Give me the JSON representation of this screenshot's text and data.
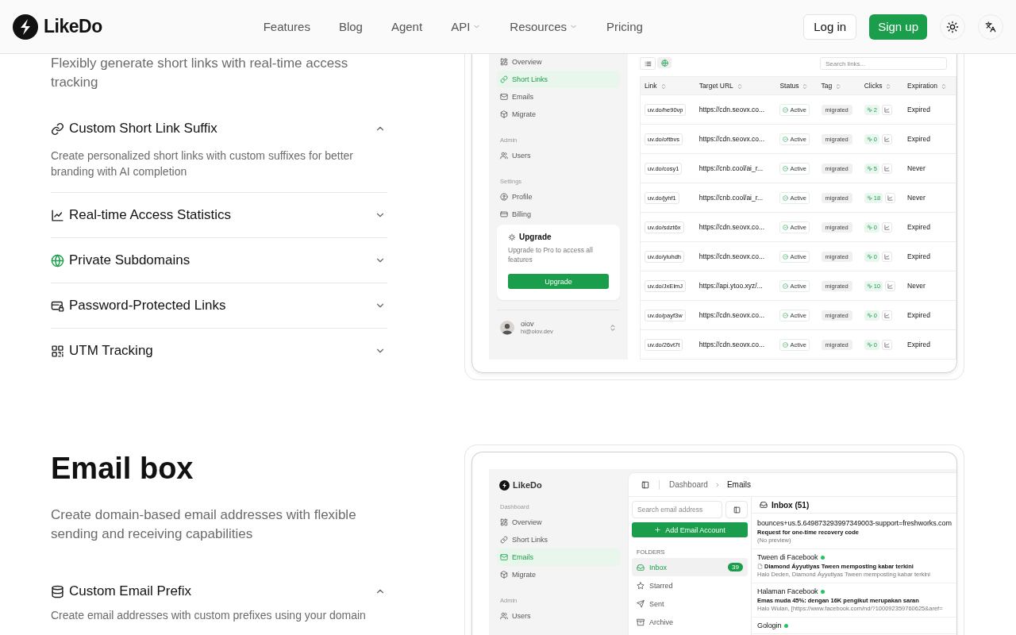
{
  "header": {
    "logo": "LikeDo",
    "nav": [
      {
        "label": "Features",
        "dropdown": false
      },
      {
        "label": "Blog",
        "dropdown": false
      },
      {
        "label": "Agent",
        "dropdown": false
      },
      {
        "label": "API",
        "dropdown": true
      },
      {
        "label": "Resources",
        "dropdown": true
      },
      {
        "label": "Pricing",
        "dropdown": false
      }
    ],
    "login": "Log in",
    "signup": "Sign up"
  },
  "short_links": {
    "description": "Flexibly generate short links with real-time access tracking",
    "features": [
      {
        "title": "Custom Short Link Suffix",
        "expanded": true,
        "description": "Create personalized short links with custom suffixes for better branding with AI completion"
      },
      {
        "title": "Real-time Access Statistics",
        "expanded": false
      },
      {
        "title": "Private Subdomains",
        "expanded": false
      },
      {
        "title": "Password-Protected Links",
        "expanded": false
      },
      {
        "title": "UTM Tracking",
        "expanded": false
      }
    ],
    "preview": {
      "sidebar": {
        "groups": [
          {
            "items": [
              {
                "label": "Overview",
                "selected": false
              },
              {
                "label": "Short Links",
                "selected": true
              },
              {
                "label": "Emails",
                "selected": false
              },
              {
                "label": "Migrate",
                "selected": false
              }
            ]
          },
          {
            "label": "Admin",
            "items": [
              {
                "label": "Users",
                "selected": false
              }
            ]
          },
          {
            "label": "Settings",
            "items": [
              {
                "label": "Profile",
                "selected": false
              },
              {
                "label": "Billing",
                "selected": false
              }
            ]
          }
        ],
        "upgrade": {
          "title": "Upgrade",
          "text": "Upgrade to Pro to access all features",
          "button": "Upgrade"
        },
        "user": {
          "name": "oiov",
          "email": "hi@oiov.dev"
        }
      },
      "search_placeholder": "Search links...",
      "columns": [
        "Link",
        "Target URL",
        "Status",
        "Tag",
        "Clicks",
        "Expiration"
      ],
      "rows": [
        {
          "link": "uv.do/he90vp",
          "url": "https://cdn.seovx.co...",
          "status": "Active",
          "tag": "migrated",
          "clicks": "2",
          "expiration": "Expired"
        },
        {
          "link": "uv.do/oftbvs",
          "url": "https://cdn.seovx.co...",
          "status": "Active",
          "tag": "migrated",
          "clicks": "0",
          "expiration": "Expired"
        },
        {
          "link": "uv.do/cosy1",
          "url": "https://cnb.cool/ai_r...",
          "status": "Active",
          "tag": "migrated",
          "clicks": "5",
          "expiration": "Never"
        },
        {
          "link": "uv.do/jyhf1",
          "url": "https://cnb.cool/ai_r...",
          "status": "Active",
          "tag": "migrated",
          "clicks": "18",
          "expiration": "Never"
        },
        {
          "link": "uv.do/sdzt6x",
          "url": "https://cdn.seovx.co...",
          "status": "Active",
          "tag": "migrated",
          "clicks": "0",
          "expiration": "Expired"
        },
        {
          "link": "uv.do/yluhdh",
          "url": "https://cdn.seovx.co...",
          "status": "Active",
          "tag": "migrated",
          "clicks": "0",
          "expiration": "Expired"
        },
        {
          "link": "uv.do/JxElmJ",
          "url": "https://api.ytoo.xyz/...",
          "status": "Active",
          "tag": "migrated",
          "clicks": "10",
          "expiration": "Never"
        },
        {
          "link": "uv.do/payf3w",
          "url": "https://cdn.seovx.co...",
          "status": "Active",
          "tag": "migrated",
          "clicks": "0",
          "expiration": "Expired"
        },
        {
          "link": "uv.do/26vt7t",
          "url": "https://cdn.seovx.co...",
          "status": "Active",
          "tag": "migrated",
          "clicks": "0",
          "expiration": "Expired"
        }
      ]
    }
  },
  "email_box": {
    "title": "Email box",
    "description": "Create domain-based email addresses with flexible sending and receiving capabilities",
    "features": [
      {
        "title": "Custom Email Prefix",
        "expanded": true,
        "description": "Create email addresses with custom prefixes using your domain"
      }
    ],
    "preview": {
      "logo": "LikeDo",
      "sidebar": {
        "groups": [
          {
            "label": "Dashboard",
            "items": [
              {
                "label": "Overview",
                "selected": false
              },
              {
                "label": "Short Links",
                "selected": false
              },
              {
                "label": "Emails",
                "selected": true
              },
              {
                "label": "Migrate",
                "selected": false
              }
            ]
          },
          {
            "label": "Admin",
            "items": [
              {
                "label": "Users",
                "selected": false
              }
            ]
          }
        ]
      },
      "breadcrumb": [
        "Dashboard",
        "Emails"
      ],
      "search_placeholder": "Search email address",
      "add_button": "Add Email Account",
      "folders_label": "FOLDERS",
      "folders": [
        {
          "label": "Inbox",
          "selected": true,
          "count": "39"
        },
        {
          "label": "Starred",
          "selected": false
        },
        {
          "label": "Sent",
          "selected": false
        },
        {
          "label": "Archive",
          "selected": false
        }
      ],
      "inbox_title": "Inbox (51)",
      "emails": [
        {
          "sender": "bounces+us.5.649873293997349003-support=freshworks.com",
          "unread": false,
          "subject": "Request for one-time recovery code",
          "has_icon": false,
          "preview": "(No preview)"
        },
        {
          "sender": "Tween di Facebook",
          "unread": true,
          "subject": "Diamond Áyyutiyas Tween memposting kabar terkini",
          "has_icon": true,
          "preview": "Halo Deden, Diamond Áyyutiyas Tween memposting kabar terkini"
        },
        {
          "sender": "Halaman Facebook",
          "unread": true,
          "subject": "Emas muda 45%: dengan 16K pengikut merupakan saran",
          "has_icon": false,
          "preview": "Halo Wulan, [https://www.facebook.com/nd/?100092359760625&aref="
        },
        {
          "sender": "Gologin",
          "unread": true
        }
      ]
    }
  }
}
